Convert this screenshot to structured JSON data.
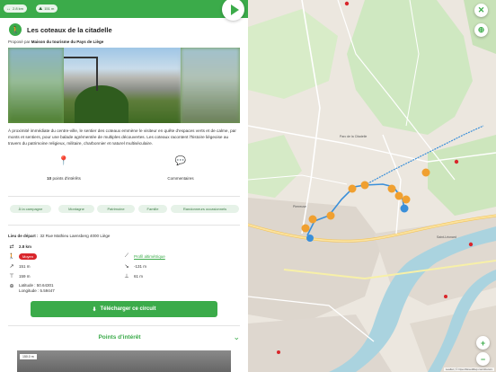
{
  "header": {
    "distance_badge": "2.8 km",
    "elevation_badge": "151 m"
  },
  "route": {
    "title": "Les coteaux de la citadelle",
    "proposed_prefix": "Proposé par",
    "proposed_by": "Maison du tourisme du Pays de Liège",
    "description": "À proximité immédiate du centre-ville, le sentier des coteaux emmène le visiteur en quête d'espaces verts et de calme, par monts et sentiers, pour une balade agrémentée de multiples découvertes. Les coteaux racontent l'histoire liégeoise au travers du patrimoine religieux, militaire, charbonnier et naturel multiséculaire."
  },
  "stats": {
    "points_count": "10",
    "points_label": "points d'intérêts",
    "comments_label": "Commentaires"
  },
  "tags": [
    "À la campagne",
    "Montagne",
    "Patrimoine",
    "Famille",
    "Randonneurs occasionnels"
  ],
  "info": {
    "start_label": "Lieu de départ :",
    "start_value": "32 Rue Mathieu Laensberg 4000 Liège",
    "distance": "2.8 km",
    "difficulty": "Moyen",
    "profile_link": "Profil altimétrique",
    "ascent": "151 m",
    "descent": "-131 m",
    "max_alt": "159 m",
    "min_alt": "61 m",
    "latitude": "Latitude : 50.64301",
    "longitude": "Longitude : 5.59447"
  },
  "actions": {
    "download_label": "Télécharger ce circuit",
    "poi_label": "Points d'intérêt"
  },
  "photo_scale": "150.0 m",
  "map": {
    "labels": {
      "park": "Parc de la Citadelle",
      "district": "Pierreuse",
      "leonard": "Saint-Léonard"
    },
    "attribution": "Leaflet | © OpenStreetMap contributors",
    "colors": {
      "route": "#3a8fd9",
      "poi": "#f0a030",
      "accent": "#3bab4a"
    }
  }
}
